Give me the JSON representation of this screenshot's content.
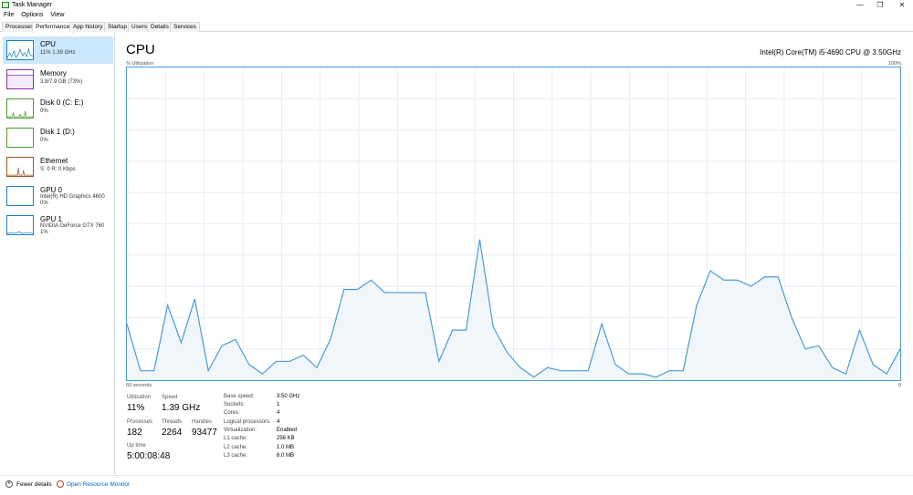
{
  "window": {
    "title": "Task Manager",
    "minimize_glyph": "—",
    "maximize_glyph": "❐",
    "close_glyph": "✕"
  },
  "menu": [
    "File",
    "Options",
    "View"
  ],
  "tabs": [
    "Processes",
    "Performance",
    "App history",
    "Startup",
    "Users",
    "Details",
    "Services"
  ],
  "active_tab": "Performance",
  "sidebar": {
    "items": [
      {
        "name": "CPU",
        "lines": [
          "11% 1.39 GHz"
        ],
        "color": "#1a82c4"
      },
      {
        "name": "Memory",
        "lines": [
          "3.8/7.9 GB (73%)"
        ],
        "color": "#8b2fb3"
      },
      {
        "name": "Disk 0 (C: E:)",
        "lines": [
          "0%"
        ],
        "color": "#4aa02c"
      },
      {
        "name": "Disk 1 (D:)",
        "lines": [
          "0%"
        ],
        "color": "#4aa02c"
      },
      {
        "name": "Ethernet",
        "lines": [
          "S: 0 R: 0 Kbps"
        ],
        "color": "#a75420"
      },
      {
        "name": "GPU 0",
        "lines": [
          "Intel(R) HD Graphics 4600",
          "0%"
        ],
        "color": "#1a82c4"
      },
      {
        "name": "GPU 1",
        "lines": [
          "NVIDIA GeForce GTX 760",
          "1%"
        ],
        "color": "#1a82c4"
      }
    ]
  },
  "main": {
    "title": "CPU",
    "cpu_model": "Intel(R) Core(TM) i5-4690 CPU @ 3.50GHz",
    "graph_label": "% Utilization",
    "graph_max": "100%",
    "time_label": "60 seconds",
    "time_end": "0",
    "graph_color": "#4a9bd6",
    "graph_fill": "#f1f6fb",
    "utilization_series": [
      18,
      3,
      3,
      24,
      12,
      26,
      3,
      11,
      13,
      5,
      2,
      6,
      6,
      8,
      4,
      13,
      29,
      29,
      32,
      28,
      28,
      28,
      28,
      6,
      16,
      16,
      45,
      17,
      9,
      4,
      1,
      4,
      3,
      3,
      3,
      18,
      5,
      2,
      2,
      1,
      3,
      3,
      24,
      35,
      32,
      32,
      30,
      33,
      33,
      20,
      10,
      11,
      4,
      2,
      16,
      5,
      2,
      10
    ]
  },
  "stats": {
    "utilization": {
      "label": "Utilization",
      "value": "11%"
    },
    "speed": {
      "label": "Speed",
      "value": "1.39 GHz"
    },
    "processes": {
      "label": "Processes",
      "value": "182"
    },
    "threads": {
      "label": "Threads",
      "value": "2264"
    },
    "handles": {
      "label": "Handles",
      "value": "93477"
    },
    "uptime": {
      "label": "Up time",
      "value": "5:00:08:48"
    }
  },
  "info": [
    {
      "key": "Base speed:",
      "value": "3.50 GHz"
    },
    {
      "key": "Sockets:",
      "value": "1"
    },
    {
      "key": "Cores:",
      "value": "4"
    },
    {
      "key": "Logical processors:",
      "value": "4"
    },
    {
      "key": "Virtualization:",
      "value": "Enabled"
    },
    {
      "key": "L1 cache:",
      "value": "256 KB"
    },
    {
      "key": "L2 cache:",
      "value": "1.0 MB"
    },
    {
      "key": "L3 cache:",
      "value": "6.0 MB"
    }
  ],
  "footer": {
    "fewer_details": "Fewer details",
    "open_resource_monitor": "Open Resource Monitor",
    "link_color": "#0066cc"
  }
}
